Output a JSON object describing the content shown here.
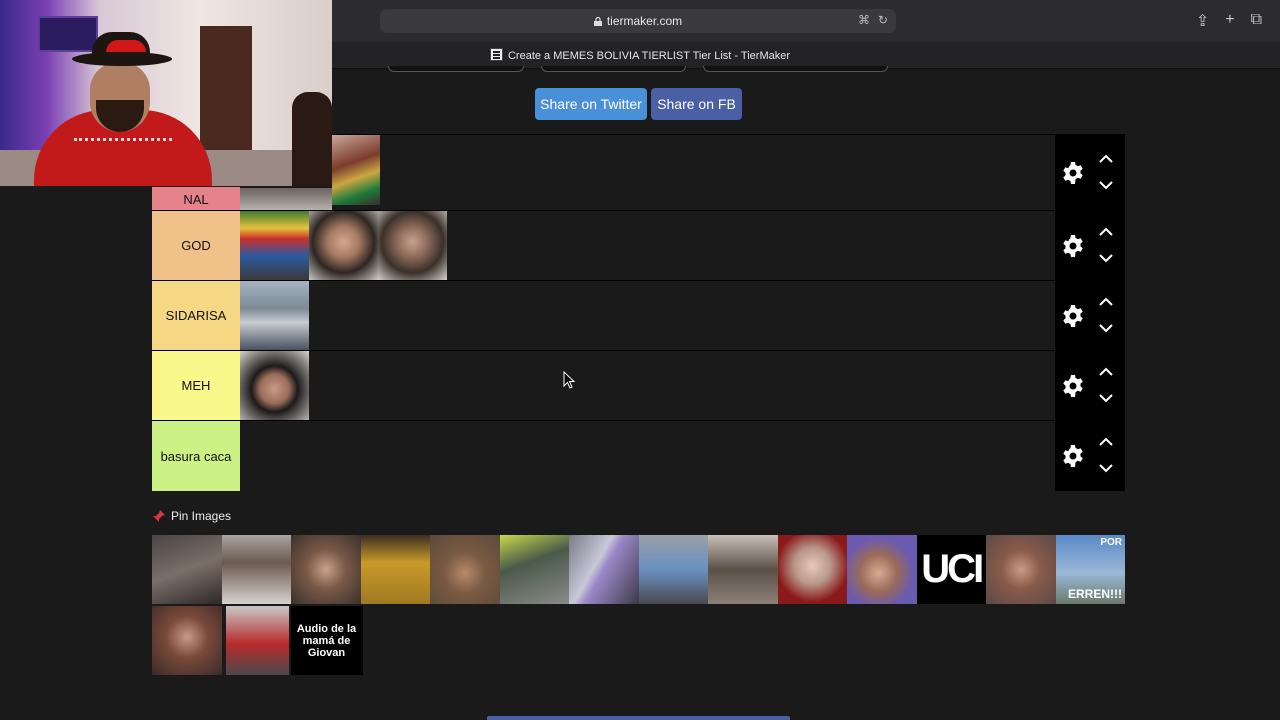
{
  "browser": {
    "url": "tiermaker.com",
    "tab_title": "Create a MEMES BOLIVIA TIERLIST Tier List - TierMaker"
  },
  "share": {
    "twitter_label": "Share on Twitter",
    "fb_label": "Share on FB"
  },
  "tiers": [
    {
      "label": "NAL",
      "color": "#e5828a"
    },
    {
      "label": "GOD",
      "color": "#f0c28a"
    },
    {
      "label": "SIDARISA",
      "color": "#f6d784"
    },
    {
      "label": "MEH",
      "color": "#f9f88a"
    },
    {
      "label": "basura caca",
      "color": "#ccf185"
    }
  ],
  "pin": {
    "header": "Pin Images"
  },
  "pin_tiles": {
    "uci_text": "UCI",
    "audio_text": "Audio de la mamá de Giovan",
    "errem_text": "ERREN!!!",
    "por_text": "POR"
  }
}
